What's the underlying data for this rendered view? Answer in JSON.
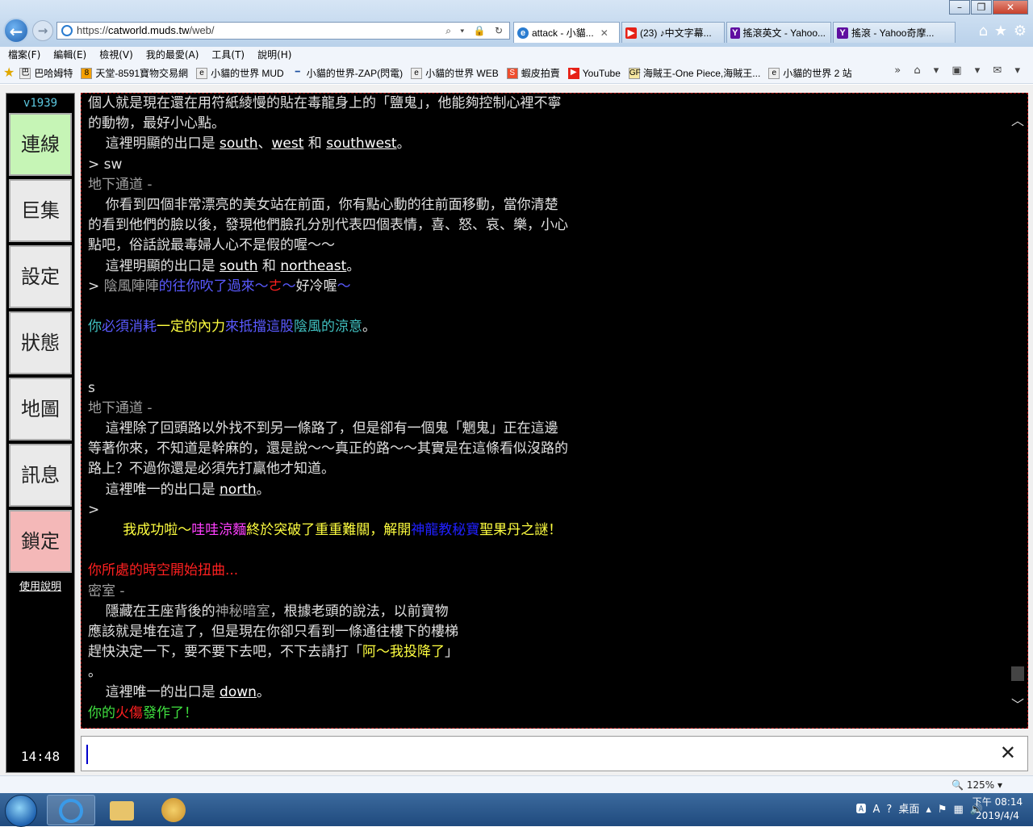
{
  "browser": {
    "address": {
      "scheme": "https://",
      "domain": "catworld.muds.tw",
      "path": "/web/"
    },
    "tabs": [
      {
        "label": "attack - 小貓...",
        "icon": "ie-page-icon",
        "color": "#2a7cd0",
        "active": true
      },
      {
        "label": "(23) ♪中文字幕...",
        "icon": "youtube-icon",
        "color": "#e62117"
      },
      {
        "label": "搖滾英文 - Yahoo...",
        "icon": "yahoo-icon",
        "color": "#5f0fa0"
      },
      {
        "label": "搖滾 - Yahoo奇摩...",
        "icon": "yahoo-icon",
        "color": "#5f0fa0"
      }
    ],
    "menu": [
      "檔案(F)",
      "編輯(E)",
      "檢視(V)",
      "我的最愛(A)",
      "工具(T)",
      "說明(H)"
    ],
    "favorites": [
      "巴哈姆特",
      "天堂-8591寶物交易網",
      "小貓的世界 MUD",
      "小貓的世界-ZAP(閃電)",
      "小貓的世界 WEB",
      "蝦皮拍賣",
      "YouTube",
      "海賊王-One Piece,海賊王...",
      "小貓的世界 2 站"
    ],
    "zoom": "125%"
  },
  "sidebar": {
    "version": "v1939",
    "buttons": [
      "連線",
      "巨集",
      "設定",
      "狀態",
      "地圖",
      "訊息",
      "鎖定"
    ],
    "help": "使用說明",
    "time": "14:48"
  },
  "terminal_lines": [
    [
      {
        "t": "個人就是現在還在用符紙綾慢的貼在毒龍身上的「鹽鬼」，他能夠控制心裡不寧",
        "c": "#e0e0e0"
      }
    ],
    [
      {
        "t": "的動物，最好小心點。",
        "c": "#e0e0e0"
      }
    ],
    [
      {
        "t": "    這裡明顯的出口是 ",
        "c": "#e0e0e0"
      },
      {
        "t": "south",
        "c": "#ffffff",
        "u": true
      },
      {
        "t": "、",
        "c": "#e0e0e0"
      },
      {
        "t": "west",
        "c": "#ffffff",
        "u": true
      },
      {
        "t": " 和 ",
        "c": "#e0e0e0"
      },
      {
        "t": "southwest",
        "c": "#ffffff",
        "u": true
      },
      {
        "t": "。",
        "c": "#e0e0e0"
      }
    ],
    [
      {
        "t": "> sw",
        "c": "#e0e0e0"
      }
    ],
    [
      {
        "t": "地下通道 -",
        "c": "#a0a0a0"
      }
    ],
    [
      {
        "t": "    你看到四個非常漂亮的美女站在前面，你有點心動的往前面移動，當你清楚",
        "c": "#e0e0e0"
      }
    ],
    [
      {
        "t": "的看到他們的臉以後，發現他們臉孔分別代表四個表情，喜、怒、哀、樂，小心",
        "c": "#e0e0e0"
      }
    ],
    [
      {
        "t": "點吧，俗話說最毒婦人心不是假的喔～～",
        "c": "#e0e0e0"
      }
    ],
    [
      {
        "t": "    這裡明顯的出口是 ",
        "c": "#e0e0e0"
      },
      {
        "t": "south",
        "c": "#ffffff",
        "u": true
      },
      {
        "t": " 和 ",
        "c": "#e0e0e0"
      },
      {
        "t": "northeast",
        "c": "#ffffff",
        "u": true
      },
      {
        "t": "。",
        "c": "#e0e0e0"
      }
    ],
    [
      {
        "t": "> ",
        "c": "#e0e0e0"
      },
      {
        "t": "陰風陣陣",
        "c": "#a0a0a0"
      },
      {
        "t": "的往你吹了過來～",
        "c": "#5a5aff"
      },
      {
        "t": "ㄜ",
        "c": "#ff2020"
      },
      {
        "t": "～",
        "c": "#5a5aff"
      },
      {
        "t": "好冷喔",
        "c": "#e0e0e0"
      },
      {
        "t": "～",
        "c": "#5a5aff"
      }
    ],
    [
      {
        "t": "",
        "c": "#e0e0e0"
      }
    ],
    [
      {
        "t": "你",
        "c": "#40c0c0"
      },
      {
        "t": "必須消耗",
        "c": "#5a5aff"
      },
      {
        "t": "一定的內力",
        "c": "#ffff40"
      },
      {
        "t": "來抵擋這股",
        "c": "#5a5aff"
      },
      {
        "t": "陰風的涼意",
        "c": "#40c0c0"
      },
      {
        "t": "。",
        "c": "#e0e0e0"
      }
    ],
    [
      {
        "t": "",
        "c": "#e0e0e0"
      }
    ],
    [
      {
        "t": "",
        "c": "#e0e0e0"
      }
    ],
    [
      {
        "t": "s",
        "c": "#e0e0e0"
      }
    ],
    [
      {
        "t": "地下通道 -",
        "c": "#a0a0a0"
      }
    ],
    [
      {
        "t": "    這裡除了回頭路以外找不到另一條路了，但是卻有一個鬼「魍鬼」正在這邊",
        "c": "#e0e0e0"
      }
    ],
    [
      {
        "t": "等著你來，不知道是幹麻的，還是說～～真正的路～～其實是在這條看似沒路的",
        "c": "#e0e0e0"
      }
    ],
    [
      {
        "t": "路上？不過你還是必須先打贏他才知道。",
        "c": "#e0e0e0"
      }
    ],
    [
      {
        "t": "    這裡唯一的出口是 ",
        "c": "#e0e0e0"
      },
      {
        "t": "north",
        "c": "#ffffff",
        "u": true
      },
      {
        "t": "。",
        "c": "#e0e0e0"
      }
    ],
    [
      {
        "t": ">",
        "c": "#e0e0e0"
      }
    ],
    [
      {
        "t": "        我成功啦～",
        "c": "#ffff40"
      },
      {
        "t": "哇哇涼麵",
        "c": "#ff40ff"
      },
      {
        "t": "終於突破了重重難關，解開",
        "c": "#ffff40"
      },
      {
        "t": "神龍教秘寶",
        "c": "#2020ff"
      },
      {
        "t": "聖果丹之謎！",
        "c": "#ffff40"
      }
    ],
    [
      {
        "t": "",
        "c": "#e0e0e0"
      }
    ],
    [
      {
        "t": "你所處的時空開始扭曲...",
        "c": "#ff2020"
      }
    ],
    [
      {
        "t": "密室 -",
        "c": "#a0a0a0"
      }
    ],
    [
      {
        "t": "    隱藏在王座背後的",
        "c": "#e0e0e0"
      },
      {
        "t": "神秘暗室",
        "c": "#a0a0a0"
      },
      {
        "t": "，根據老頭的說法，以前寶物",
        "c": "#e0e0e0"
      }
    ],
    [
      {
        "t": "應該就是堆在這了，但是現在你卻只看到一條通往樓下的樓梯",
        "c": "#e0e0e0"
      }
    ],
    [
      {
        "t": "趕快決定一下，要不要下去吧，不下去請打「",
        "c": "#e0e0e0"
      },
      {
        "t": "阿～我投降了",
        "c": "#ffff40"
      },
      {
        "t": "」",
        "c": "#e0e0e0"
      }
    ],
    [
      {
        "t": "。",
        "c": "#e0e0e0"
      }
    ],
    [
      {
        "t": "    這裡唯一的出口是 ",
        "c": "#e0e0e0"
      },
      {
        "t": "down",
        "c": "#ffffff",
        "u": true
      },
      {
        "t": "。",
        "c": "#e0e0e0"
      }
    ],
    [
      {
        "t": "你的",
        "c": "#40e040"
      },
      {
        "t": "火傷",
        "c": "#ff2020"
      },
      {
        "t": "發作了！",
        "c": "#40e040"
      }
    ]
  ],
  "taskbar": {
    "tray_ime": "桌面",
    "time": "下午 08:14",
    "date": "2019/4/4"
  }
}
